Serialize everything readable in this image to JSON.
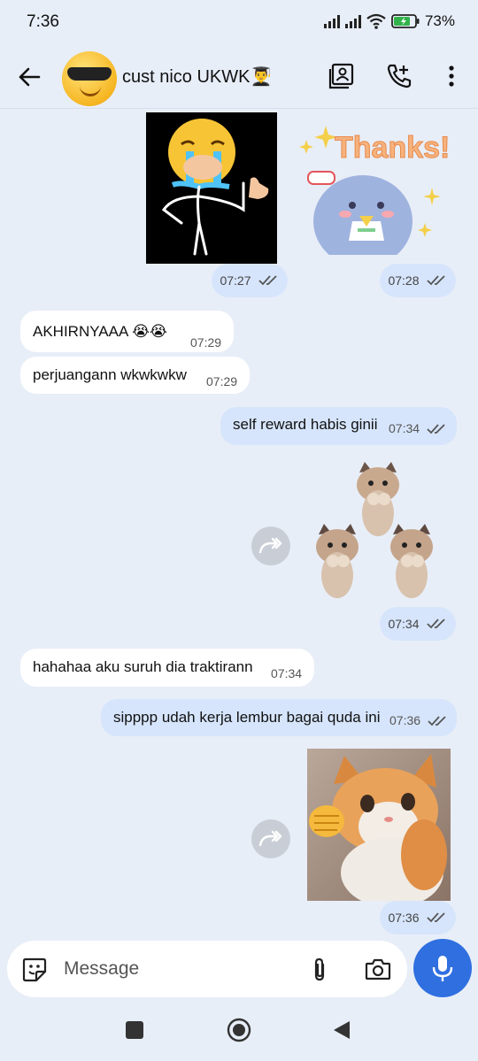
{
  "status": {
    "time": "7:36",
    "battery": "73%"
  },
  "header": {
    "title": "cust nico UKWK👨‍🎓"
  },
  "messages": [
    {
      "time": "07:27"
    },
    {
      "time": "07:28"
    },
    {
      "text": "AKHIRNYAAA 😭😭",
      "time": "07:29"
    },
    {
      "text": "perjuangann wkwkwkw",
      "time": "07:29"
    },
    {
      "text": "self reward habis ginii",
      "time": "07:34"
    },
    {
      "time": "07:34"
    },
    {
      "text": "hahahaa aku suruh dia traktirann",
      "time": "07:34"
    },
    {
      "text": "sipppp udah kerja lembur bagai quda ini",
      "time": "07:36"
    },
    {
      "time": "07:36"
    }
  ],
  "stickers": {
    "thanks_text": "Thanks!"
  },
  "composer": {
    "placeholder": "Message"
  },
  "colors": {
    "background": "#e8eef8",
    "incoming": "#ffffff",
    "outgoing": "#d6e5fb",
    "accent": "#2f6fe0"
  }
}
